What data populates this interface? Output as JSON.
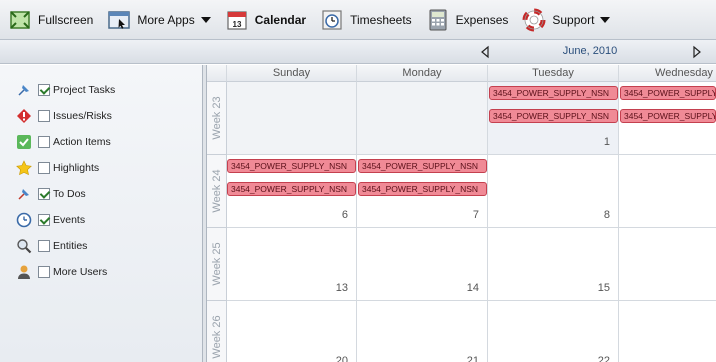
{
  "toolbar": {
    "fullscreen": "Fullscreen",
    "more_apps": "More Apps",
    "calendar": "Calendar",
    "calendar_icon_day": "13",
    "timesheets": "Timesheets",
    "expenses": "Expenses",
    "support": "Support"
  },
  "nav": {
    "month": "June, 2010"
  },
  "sidebar": {
    "items": [
      {
        "label": "Project Tasks",
        "checked": true,
        "icon": "pin-icon"
      },
      {
        "label": "Issues/Risks",
        "checked": false,
        "icon": "alert-icon"
      },
      {
        "label": "Action Items",
        "checked": false,
        "icon": "check-icon"
      },
      {
        "label": "Highlights",
        "checked": false,
        "icon": "star-icon"
      },
      {
        "label": "To Dos",
        "checked": true,
        "icon": "pin-icon"
      },
      {
        "label": "Events",
        "checked": true,
        "icon": "clock-icon"
      },
      {
        "label": "Entities",
        "checked": false,
        "icon": "magnifier-icon"
      },
      {
        "label": "More Users",
        "checked": false,
        "icon": "user-icon"
      }
    ]
  },
  "calendar": {
    "days": [
      "Sunday",
      "Monday",
      "Tuesday",
      "Wednesday"
    ],
    "weeks": [
      {
        "label": "Week 23",
        "dates": [
          "",
          "",
          "1",
          ""
        ]
      },
      {
        "label": "Week 24",
        "dates": [
          "6",
          "7",
          "8",
          ""
        ]
      },
      {
        "label": "Week 25",
        "dates": [
          "13",
          "14",
          "15",
          ""
        ]
      },
      {
        "label": "Week 26",
        "dates": [
          "20",
          "21",
          "22",
          ""
        ]
      }
    ],
    "event_title": "3454_POWER_SUPPLY_NSN"
  },
  "colors": {
    "event_fill": "#f08a96",
    "event_border": "#c4404f",
    "nav_text": "#2b4f7c"
  }
}
